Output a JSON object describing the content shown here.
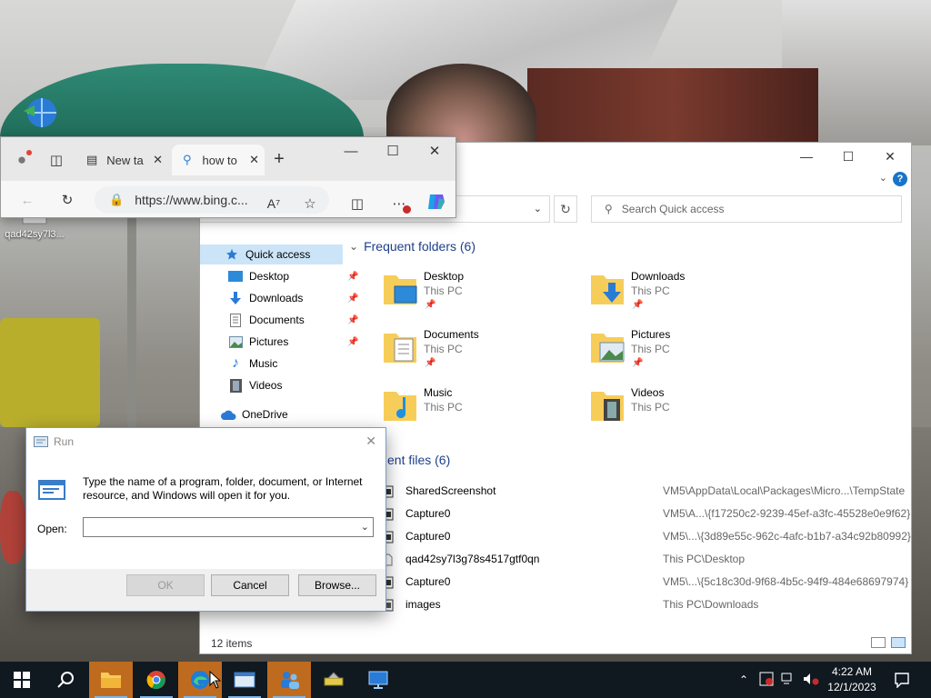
{
  "desktop": {
    "icons": [
      {
        "label": "qad42sy7l3...",
        "icon": "image-file-icon"
      }
    ]
  },
  "explorer": {
    "search_placeholder": "Search Quick access",
    "nav": [
      {
        "label": "Quick access",
        "icon": "star-icon",
        "selected": true
      },
      {
        "label": "Desktop",
        "icon": "desktop-folder-icon",
        "pinned": true
      },
      {
        "label": "Downloads",
        "icon": "download-arrow-icon",
        "pinned": true
      },
      {
        "label": "Documents",
        "icon": "documents-icon",
        "pinned": true
      },
      {
        "label": "Pictures",
        "icon": "pictures-icon",
        "pinned": true
      },
      {
        "label": "Music",
        "icon": "music-note-icon",
        "pinned": false
      },
      {
        "label": "Videos",
        "icon": "film-icon",
        "pinned": false
      },
      {
        "label": "OneDrive",
        "icon": "cloud-icon",
        "pinned": false
      }
    ],
    "frequent_header": "Frequent folders (6)",
    "frequent": [
      {
        "name": "Desktop",
        "location": "This PC",
        "pinned": true
      },
      {
        "name": "Downloads",
        "location": "This PC",
        "pinned": true
      },
      {
        "name": "Documents",
        "location": "This PC",
        "pinned": true
      },
      {
        "name": "Pictures",
        "location": "This PC",
        "pinned": true
      },
      {
        "name": "Music",
        "location": "This PC",
        "pinned": false
      },
      {
        "name": "Videos",
        "location": "This PC",
        "pinned": false
      }
    ],
    "recent_header": "ent files (6)",
    "recent": [
      {
        "name": "SharedScreenshot",
        "path": "VM5\\AppData\\Local\\Packages\\Micro...\\TempState"
      },
      {
        "name": "Capture0",
        "path": "VM5\\A...\\{f17250c2-9239-45ef-a3fc-45528e0e9f62}"
      },
      {
        "name": "Capture0",
        "path": "VM5\\...\\{3d89e55c-962c-4afc-b1b7-a34c92b80992}"
      },
      {
        "name": "qad42sy7l3g78s4517gtf0qn",
        "path": "This PC\\Desktop"
      },
      {
        "name": "Capture0",
        "path": "VM5\\...\\{5c18c30d-9f68-4b5c-94f9-484e68697974}"
      },
      {
        "name": "images",
        "path": "This PC\\Downloads"
      }
    ],
    "status": "12 items"
  },
  "edge": {
    "tabs": [
      {
        "label": "New ta"
      },
      {
        "label": "how to"
      }
    ],
    "url": "https://www.bing.c..."
  },
  "run": {
    "title": "Run",
    "description": "Type the name of a program, folder, document, or Internet resource, and Windows will open it for you.",
    "open_label": "Open:",
    "open_value": "",
    "ok": "OK",
    "cancel": "Cancel",
    "browse": "Browse..."
  },
  "taskbar": {
    "time": "4:22 AM",
    "date": "12/1/2023"
  },
  "colors": {
    "accent": "#0078d4",
    "folder": "#f7cd5a",
    "taskbar": "#101820",
    "taskbar_active": "#bf6b1f"
  }
}
